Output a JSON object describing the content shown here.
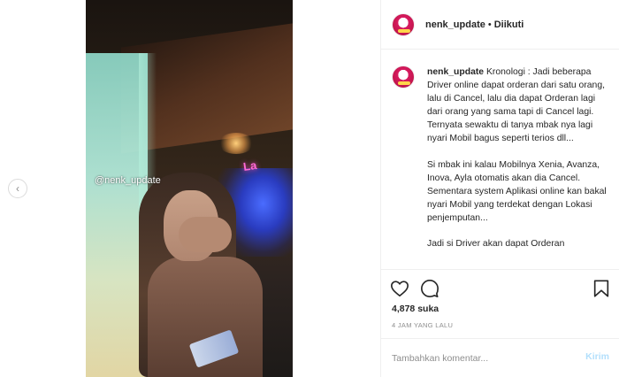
{
  "post": {
    "watermark": "@nenk_update",
    "media_sign_text": "La"
  },
  "header": {
    "username": "nenk_update",
    "separator": "•",
    "follow_status": "Diikuti"
  },
  "caption": {
    "username": "nenk_update",
    "paragraph_1": "Kronologi : Jadi beberapa Driver online dapat orderan dari satu orang, lalu di Cancel, lalu dia dapat Orderan lagi dari orang yang sama tapi di Cancel lagi. Ternyata sewaktu di tanya mbak nya lagi nyari Mobil bagus seperti terios dll...",
    "paragraph_2": "Si mbak ini kalau Mobilnya Xenia, Avanza, Inova, Ayla otomatis akan dia Cancel. Sementara system Aplikasi online kan bakal nyari Mobil yang terdekat dengan Lokasi penjemputan...",
    "paragraph_3": "Jadi si Driver akan dapat Orderan"
  },
  "actions": {
    "like_icon": "heart-icon",
    "comment_icon": "comment-icon",
    "save_icon": "bookmark-icon"
  },
  "stats": {
    "likes": "4,878 suka",
    "timestamp": "4 JAM YANG LALU"
  },
  "comment_box": {
    "placeholder": "Tambahkan komentar...",
    "post_label": "Kirim"
  },
  "colors": {
    "text": "#262626",
    "muted": "#8e8e8e",
    "border": "#efefef",
    "post_button_disabled": "#b2dffc"
  }
}
